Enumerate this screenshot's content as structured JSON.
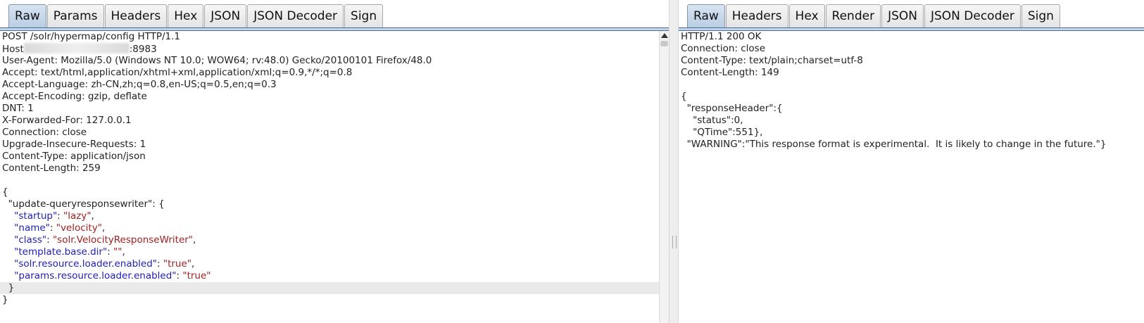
{
  "request": {
    "tabs": [
      "Raw",
      "Params",
      "Headers",
      "Hex",
      "JSON",
      "JSON Decoder",
      "Sign"
    ],
    "active_tab": "Raw",
    "request_line": "POST /solr/hypermap/config HTTP/1.1",
    "host_prefix": "Host",
    "host_port": ":8983",
    "headers": [
      "User-Agent: Mozilla/5.0 (Windows NT 10.0; WOW64; rv:48.0) Gecko/20100101 Firefox/48.0",
      "Accept: text/html,application/xhtml+xml,application/xml;q=0.9,*/*;q=0.8",
      "Accept-Language: zh-CN,zh;q=0.8,en-US;q=0.5,en;q=0.3",
      "Accept-Encoding: gzip, deflate",
      "DNT: 1",
      "X-Forwarded-For: 127.0.0.1",
      "Connection: close",
      "Upgrade-Insecure-Requests: 1",
      "Content-Type: application/json",
      "Content-Length: 259"
    ],
    "body": {
      "open_brace": "{",
      "object_key": "\"update-queryresponsewriter\": {",
      "props": [
        {
          "key": "\"startup\"",
          "sep": ": ",
          "value": "\"lazy\"",
          "tail": ","
        },
        {
          "key": "\"name\"",
          "sep": ": ",
          "value": "\"velocity\"",
          "tail": ","
        },
        {
          "key": "\"class\"",
          "sep": ": ",
          "value": "\"solr.VelocityResponseWriter\"",
          "tail": ","
        },
        {
          "key": "\"template.base.dir\"",
          "sep": ": ",
          "value": "\"\"",
          "tail": ","
        },
        {
          "key": "\"solr.resource.loader.enabled\"",
          "sep": ": ",
          "value": "\"true\"",
          "tail": ","
        },
        {
          "key": "\"params.resource.loader.enabled\"",
          "sep": ": ",
          "value": "\"true\"",
          "tail": ""
        }
      ],
      "inner_close": "}",
      "close_brace": "}"
    }
  },
  "response": {
    "tabs": [
      "Raw",
      "Headers",
      "Hex",
      "Render",
      "JSON",
      "JSON Decoder",
      "Sign"
    ],
    "active_tab": "Raw",
    "status_line": "HTTP/1.1 200 OK",
    "headers": [
      "Connection: close",
      "Content-Type: text/plain;charset=utf-8",
      "Content-Length: 149"
    ],
    "body": [
      "{",
      "  \"responseHeader\":{",
      "    \"status\":0,",
      "    \"QTime\":551},",
      "  \"WARNING\":\"This response format is experimental.  It is likely to change in the future.\"}"
    ]
  },
  "colors": {
    "active_tab": "#c9d9ec",
    "json_key": "#2020b8",
    "json_string": "#a02020",
    "tab_rule": "#4a6d94"
  }
}
